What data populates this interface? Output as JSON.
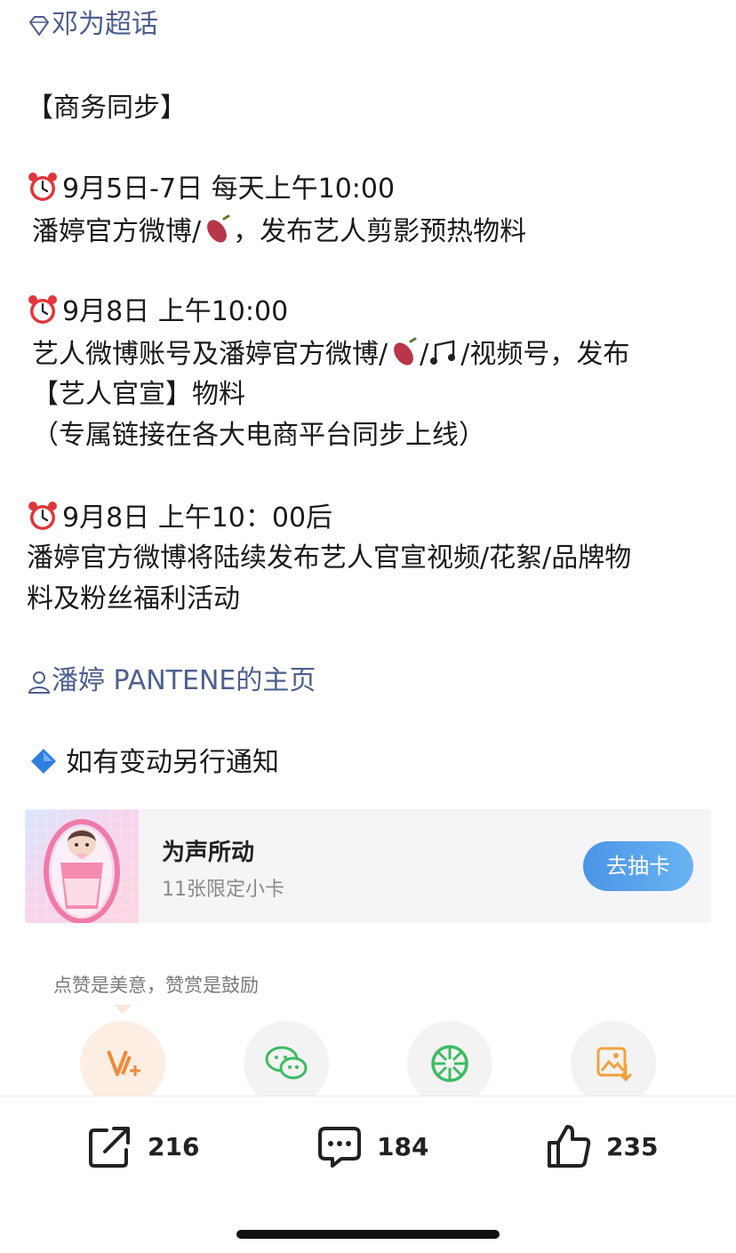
{
  "post": {
    "topic_link": "邓为超话",
    "heading": "【商务同步】",
    "s1_time": "9月5日-7日 每天上午10:00",
    "s1_body_a": "潘婷官方微博/",
    "s1_body_b": "，发布艺人剪影预热物料",
    "s2_time": "9月8日 上午10:00",
    "s2_body_a": "艺人微博账号及潘婷官方微博/",
    "s2_body_b": "/",
    "s2_body_c": "/视频号，发布",
    "s2_body_d": "【艺人官宣】物料",
    "s2_note": "（专属链接在各大电商平台同步上线）",
    "s3_time": "9月8日 上午10：00后",
    "s3_body_1": "潘婷官方微博将陆续发布艺人官宣视频/花絮/品牌物",
    "s3_body_2": "料及粉丝福利活动",
    "profile_link": "潘婷 PANTENE的主页",
    "notice": "如有变动另行通知"
  },
  "card": {
    "title": "为声所动",
    "subtitle": "11张限定小卡",
    "button": "去抽卡"
  },
  "reward": {
    "tip": "点赞是美意，赞赏是鼓励",
    "buttons": [
      "v-plus-icon",
      "wechat-icon",
      "moments-icon",
      "save-image-icon"
    ]
  },
  "actions": {
    "repost_count": "216",
    "comment_count": "184",
    "like_count": "235"
  },
  "colors": {
    "link": "#4d5f8c",
    "accent_orange": "#f08a3c",
    "button_blue": "#4b94e6",
    "green": "#3dbb63"
  }
}
